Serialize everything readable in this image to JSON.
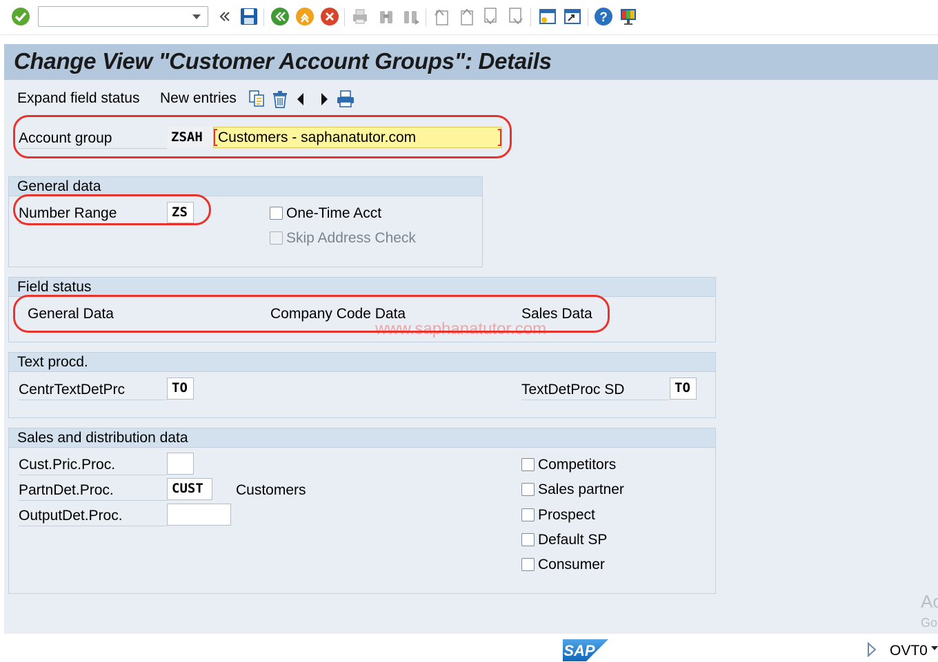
{
  "toolbar": {
    "command_field_value": "",
    "icons": [
      "enter-icon",
      "back-icon",
      "save-icon",
      "back-green-icon",
      "exit-icon",
      "cancel-icon",
      "print-icon",
      "find-icon",
      "find-next-icon",
      "first-page-icon",
      "previous-page-icon",
      "next-page-icon",
      "last-page-icon",
      "create-session-icon",
      "shortcut-icon",
      "help-icon",
      "customize-layout-icon"
    ]
  },
  "page": {
    "title": "Change View \"Customer Account Groups\": Details"
  },
  "app_toolbar": {
    "expand_field_status": "Expand field status",
    "new_entries": "New entries"
  },
  "header": {
    "account_group_label": "Account group",
    "account_group_value": "ZSAH",
    "description_value": "Customers - saphanatutor.com"
  },
  "general_data": {
    "title": "General data",
    "number_range_label": "Number Range",
    "number_range_value": "ZS",
    "one_time_acct_label": "One-Time Acct",
    "skip_address_check_label": "Skip Address Check"
  },
  "field_status": {
    "title": "Field status",
    "general_data": "General Data",
    "company_code_data": "Company Code Data",
    "sales_data": "Sales Data",
    "watermark": "www.saphanatutor.com"
  },
  "text_procd": {
    "title": "Text procd.",
    "centr_label": "CentrTextDetPrc",
    "centr_value": "TO",
    "sd_label": "TextDetProc SD",
    "sd_value": "TO"
  },
  "sales_dist": {
    "title": "Sales and distribution data",
    "cust_pric_label": "Cust.Pric.Proc.",
    "cust_pric_value": "",
    "partn_label": "PartnDet.Proc.",
    "partn_value": "CUST",
    "partn_desc": "Customers",
    "output_label": "OutputDet.Proc.",
    "output_value": "",
    "checkboxes": [
      "Competitors",
      "Sales partner",
      "Prospect",
      "Default SP",
      "Consumer"
    ]
  },
  "status": {
    "transaction": "OVT0",
    "logo": "SAP",
    "activate_line1": "Ac",
    "activate_line2": "Go"
  },
  "colors": {
    "title_bar": "#b4c8dd",
    "background": "#e8eef4",
    "highlight_red": "#e8332c",
    "required_field": "#fff59d",
    "sap_blue": "#1e73be"
  }
}
